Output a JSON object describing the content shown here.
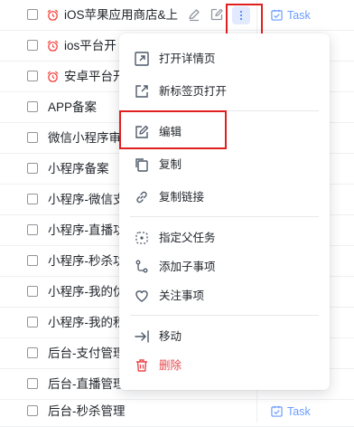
{
  "colors": {
    "accent": "#3370ff",
    "danger": "#e8484d",
    "alarm": "#f54a45",
    "highlight_box": "#e02020",
    "tag": "#6b9cff"
  },
  "rows": [
    {
      "title": "iOS苹果应用商店&上",
      "alarm": true
    },
    {
      "title": "ios平台开",
      "alarm": true
    },
    {
      "title": "安卓平台开",
      "alarm": true
    },
    {
      "title": "APP备案",
      "alarm": false
    },
    {
      "title": "微信小程序审",
      "alarm": false
    },
    {
      "title": "小程序备案",
      "alarm": false
    },
    {
      "title": "小程序-微信支",
      "alarm": false
    },
    {
      "title": "小程序-直播功",
      "alarm": false
    },
    {
      "title": "小程序-秒杀功",
      "alarm": false
    },
    {
      "title": "小程序-我的优",
      "alarm": false
    },
    {
      "title": "小程序-我的积",
      "alarm": false
    },
    {
      "title": "后台-支付管理",
      "alarm": false
    },
    {
      "title": "后台-直播管理",
      "alarm": false
    },
    {
      "title": "后台-秒杀管理",
      "alarm": false
    }
  ],
  "type_tag": "Task",
  "hover_tools": {
    "icons": [
      "pencil-icon",
      "edit-square-icon",
      "more-vertical-icon"
    ]
  },
  "context_menu": {
    "items": [
      {
        "id": "open-detail",
        "label": "打开详情页",
        "icon": "open-in-panel-icon"
      },
      {
        "id": "open-new-tab",
        "label": "新标签页打开",
        "icon": "external-link-icon"
      },
      {
        "id": "edit",
        "label": "编辑",
        "icon": "edit-icon"
      },
      {
        "id": "copy",
        "label": "复制",
        "icon": "copy-icon"
      },
      {
        "id": "copy-link",
        "label": "复制链接",
        "icon": "link-icon"
      },
      {
        "id": "set-parent",
        "label": "指定父任务",
        "icon": "parent-task-icon"
      },
      {
        "id": "add-subitem",
        "label": "添加子事项",
        "icon": "subtask-icon"
      },
      {
        "id": "follow",
        "label": "关注事项",
        "icon": "heart-icon"
      },
      {
        "id": "move",
        "label": "移动",
        "icon": "move-arrow-icon"
      },
      {
        "id": "delete",
        "label": "删除",
        "icon": "trash-icon"
      }
    ]
  }
}
